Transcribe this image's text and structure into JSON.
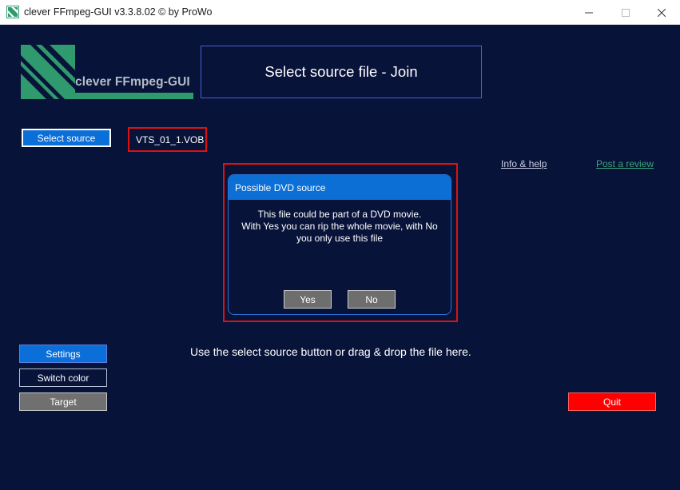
{
  "window": {
    "title": "clever FFmpeg-GUI v3.3.8.02   © by ProWo",
    "controls": {
      "minimize": "minimize-icon",
      "maximize": "maximize-icon",
      "close": "close-icon"
    }
  },
  "logo": {
    "text": "clever FFmpeg-GUI",
    "color": "#2f9a6e"
  },
  "header": {
    "title": "Select source file - Join"
  },
  "source": {
    "select_label": "Select source",
    "file_name": "VTS_01_1.VOB"
  },
  "links": {
    "info": "Info & help",
    "review": "Post a review"
  },
  "dialog": {
    "title": "Possible DVD source",
    "message_line1": "This file could be part of a DVD movie.",
    "message_line2": "With Yes you can rip the whole movie, with No",
    "message_line3": "you only use this file",
    "yes_label": "Yes",
    "no_label": "No"
  },
  "hint": "Use the select source button or drag & drop the file here.",
  "sidebar": {
    "settings_label": "Settings",
    "switch_color_label": "Switch color",
    "target_label": "Target"
  },
  "quit_label": "Quit",
  "colors": {
    "background": "#08133a",
    "accent": "#0a6fd8",
    "quit": "#ff0000",
    "highlight_border": "#e01010"
  }
}
